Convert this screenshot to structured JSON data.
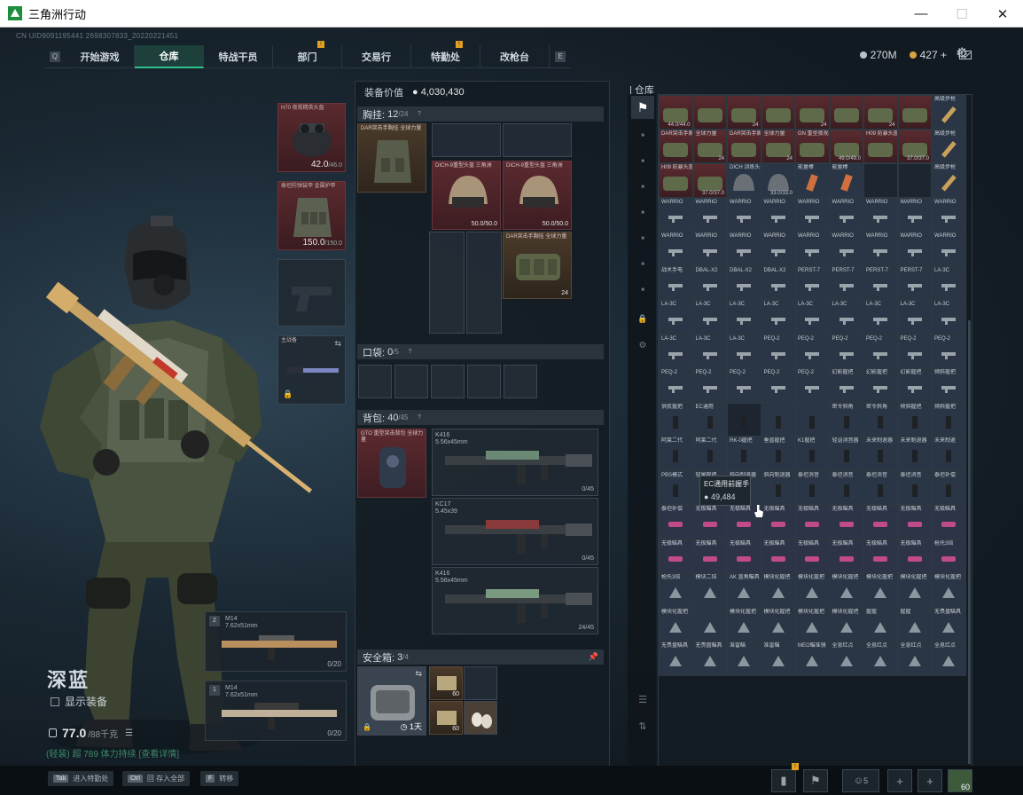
{
  "window": {
    "title": "三角洲行动"
  },
  "uid": "CN UID9091195441 2698307833_20220221451",
  "nav": {
    "key_left": "Q",
    "key_right": "E",
    "tabs": [
      {
        "label": "开始游戏",
        "active": false,
        "dot": false
      },
      {
        "label": "仓库",
        "active": true,
        "dot": false
      },
      {
        "label": "特战干员",
        "active": false,
        "dot": false
      },
      {
        "label": "部门",
        "active": false,
        "dot": true
      },
      {
        "label": "交易行",
        "active": false,
        "dot": false
      },
      {
        "label": "特勤处",
        "active": false,
        "dot": true
      },
      {
        "label": "改枪台",
        "active": false,
        "dot": false
      }
    ],
    "dot_mark": "!"
  },
  "currency": {
    "silver": "270M",
    "gold": "427",
    "gold_plus": "+"
  },
  "colors": {
    "accent": "#2fbf8a",
    "red_item": "#5a2a2e",
    "silver": "#b8c2cc",
    "gold": "#d9a441"
  },
  "player": {
    "name": "深蓝",
    "show_equip": "显示装备",
    "weight": "77.0",
    "weight_max": "/88千克",
    "status": "(轻装) 超 789  体力持续  [查看详情]"
  },
  "gear": {
    "helmet": {
      "label": "H70 夜视精英头盔",
      "dur": "42.0",
      "max": "/46.0"
    },
    "armor": {
      "label": "泰坦防弹装甲 金属护甲",
      "dur": "150.0",
      "max": "/150.0"
    },
    "melee": {
      "label": "主战备"
    },
    "primary1": {
      "num": "2",
      "name": "M14",
      "sub": "7.62x51mm",
      "ammo": "0/20"
    },
    "primary2": {
      "num": "1",
      "name": "M14",
      "sub": "7.62x51mm",
      "ammo": "0/20"
    }
  },
  "mid": {
    "value_label": "装备价值",
    "value": "4,030,430",
    "chest": {
      "label": "胸挂:",
      "value": "12",
      "max": "/24"
    },
    "chest_rig_label": "DAR突击手胸挂 全球力量",
    "chest_items": [
      {
        "label": "DICH-9重型头盔 三角洲",
        "dur": "50.0/50.0"
      },
      {
        "label": "DICH-9重型头盔 三角洲",
        "dur": "50.0/50.0"
      },
      {
        "label": "DAR突击手胸挂 全球力量",
        "dur": "24"
      }
    ],
    "pocket": {
      "label": "口袋:",
      "value": "0",
      "max": "/5"
    },
    "backpack": {
      "label": "背包:",
      "value": "40",
      "max": "/45"
    },
    "backpack_item_label": "GTO 重型突击背包 全球力量",
    "guns": [
      {
        "name": "K416",
        "sub": "5.56x45mm",
        "ammo": "0/45"
      },
      {
        "name": "KC17",
        "sub": "5.45x39",
        "ammo": "0/45"
      },
      {
        "name": "K416",
        "sub": "5.56x45mm",
        "ammo": "24/45"
      }
    ],
    "safebox": {
      "label": "安全箱:",
      "value": "3",
      "max": "/4",
      "time": "1天"
    },
    "safebox_items": [
      {
        "c": "60"
      },
      {
        "c": "60"
      }
    ]
  },
  "inventory": {
    "label": "仓库",
    "rows": [
      [
        {
          "n": "",
          "c": "44.0/44.0",
          "t": "red"
        },
        {
          "n": "",
          "c": "",
          "t": "red"
        },
        {
          "n": "",
          "c": "24",
          "t": "red"
        },
        {
          "n": "",
          "c": "",
          "t": "red"
        },
        {
          "n": "",
          "c": "24",
          "t": "red"
        },
        {
          "n": "",
          "c": "",
          "t": "red"
        },
        {
          "n": "",
          "c": "24",
          "t": "red"
        },
        {
          "n": "",
          "c": "",
          "t": "red"
        },
        {
          "n": "高级步枪",
          "c": "",
          "t": ""
        }
      ],
      [
        {
          "n": "DAR突击手胸挂",
          "c": "",
          "t": "red"
        },
        {
          "n": "全球力量",
          "c": "24",
          "t": "red"
        },
        {
          "n": "DAR突击手胸挂",
          "c": "",
          "t": "red"
        },
        {
          "n": "全球力量",
          "c": "24",
          "t": "red"
        },
        {
          "n": "GN 重型夜视头盔",
          "c": "",
          "t": "red"
        },
        {
          "n": "",
          "c": "49.0/49.0",
          "t": "red"
        },
        {
          "n": "H09 防暴头盔",
          "c": "",
          "t": "red"
        },
        {
          "n": "",
          "c": "37.0/37.0",
          "t": "red"
        },
        {
          "n": "高级步枪",
          "c": "",
          "t": ""
        }
      ],
      [
        {
          "n": "H09 防暴头盔",
          "c": "",
          "t": "red"
        },
        {
          "n": "",
          "c": "37.0/37.0",
          "t": "red"
        },
        {
          "n": "DICH 训练头盔",
          "c": "",
          "t": ""
        },
        {
          "n": "",
          "c": "33.0/33.0",
          "t": ""
        },
        {
          "n": "能量棒",
          "c": "",
          "t": ""
        },
        {
          "n": "能量棒",
          "c": "",
          "t": ""
        },
        {
          "n": "",
          "c": "",
          "t": "dark"
        },
        {
          "n": "",
          "c": "",
          "t": "dark"
        },
        {
          "n": "高级步枪",
          "c": "",
          "t": ""
        }
      ],
      [
        {
          "n": "WARRIO",
          "c": ""
        },
        {
          "n": "WARRIO",
          "c": ""
        },
        {
          "n": "WARRIO",
          "c": ""
        },
        {
          "n": "WARRIO",
          "c": ""
        },
        {
          "n": "WARRIO",
          "c": ""
        },
        {
          "n": "WARRIO",
          "c": ""
        },
        {
          "n": "WARRIO",
          "c": ""
        },
        {
          "n": "WARRIO",
          "c": ""
        },
        {
          "n": "WARRIO",
          "c": ""
        }
      ],
      [
        {
          "n": "WARRIO",
          "c": ""
        },
        {
          "n": "WARRIO",
          "c": ""
        },
        {
          "n": "WARRIO",
          "c": ""
        },
        {
          "n": "WARRIO",
          "c": ""
        },
        {
          "n": "WARRIO",
          "c": ""
        },
        {
          "n": "WARRIO",
          "c": ""
        },
        {
          "n": "WARRIO",
          "c": ""
        },
        {
          "n": "WARRIO",
          "c": ""
        },
        {
          "n": "WARRIO",
          "c": ""
        }
      ],
      [
        {
          "n": "战术手电",
          "c": ""
        },
        {
          "n": "DBAL-X2",
          "c": ""
        },
        {
          "n": "DBAL-X2",
          "c": ""
        },
        {
          "n": "DBAL-X2",
          "c": ""
        },
        {
          "n": "PERST-7",
          "c": ""
        },
        {
          "n": "PERST-7",
          "c": ""
        },
        {
          "n": "PERST-7",
          "c": ""
        },
        {
          "n": "PERST-7",
          "c": ""
        },
        {
          "n": "LA-3C",
          "c": ""
        }
      ],
      [
        {
          "n": "LA-3C",
          "c": ""
        },
        {
          "n": "LA-3C",
          "c": ""
        },
        {
          "n": "LA-3C",
          "c": ""
        },
        {
          "n": "LA-3C",
          "c": ""
        },
        {
          "n": "LA-3C",
          "c": ""
        },
        {
          "n": "LA-3C",
          "c": ""
        },
        {
          "n": "LA-3C",
          "c": ""
        },
        {
          "n": "LA-3C",
          "c": ""
        },
        {
          "n": "LA-3C",
          "c": ""
        }
      ],
      [
        {
          "n": "LA-3C",
          "c": ""
        },
        {
          "n": "LA-3C",
          "c": ""
        },
        {
          "n": "LA-3C",
          "c": ""
        },
        {
          "n": "PEQ-2",
          "c": ""
        },
        {
          "n": "PEQ-2",
          "c": ""
        },
        {
          "n": "PEQ-2",
          "c": ""
        },
        {
          "n": "PEQ-2",
          "c": ""
        },
        {
          "n": "PEQ-2",
          "c": ""
        },
        {
          "n": "PEQ-2",
          "c": ""
        }
      ],
      [
        {
          "n": "PEQ-2",
          "c": ""
        },
        {
          "n": "PEQ-2",
          "c": ""
        },
        {
          "n": "PEQ-2",
          "c": ""
        },
        {
          "n": "PEQ-2",
          "c": ""
        },
        {
          "n": "PEQ-2",
          "c": ""
        },
        {
          "n": "幻影握把",
          "c": ""
        },
        {
          "n": "幻影握把",
          "c": ""
        },
        {
          "n": "幻影握把",
          "c": ""
        },
        {
          "n": "倾斜握把",
          "c": ""
        }
      ],
      [
        {
          "n": "供航握把",
          "c": ""
        },
        {
          "n": "EC通用",
          "c": ""
        },
        {
          "n": "",
          "c": "",
          "t": "dark"
        },
        {
          "n": "",
          "c": ""
        },
        {
          "n": "",
          "c": ""
        },
        {
          "n": "密令斜角",
          "c": ""
        },
        {
          "n": "密令斜角",
          "c": ""
        },
        {
          "n": "倾斜握把",
          "c": ""
        },
        {
          "n": "倾斜握把",
          "c": ""
        }
      ],
      [
        {
          "n": "阿莱二代",
          "c": ""
        },
        {
          "n": "阿莱二代",
          "c": ""
        },
        {
          "n": "RK-0握把",
          "c": ""
        },
        {
          "n": "垂直握把",
          "c": ""
        },
        {
          "n": "K1握把",
          "c": ""
        },
        {
          "n": "轻语消音器",
          "c": ""
        },
        {
          "n": "未来制退器",
          "c": ""
        },
        {
          "n": "未来制退器",
          "c": ""
        },
        {
          "n": "未来制退",
          "c": ""
        }
      ],
      [
        {
          "n": "PBS模式",
          "c": ""
        },
        {
          "n": "轻量握把",
          "c": ""
        },
        {
          "n": "斜向制退器",
          "c": ""
        },
        {
          "n": "斜向制退器",
          "c": ""
        },
        {
          "n": "泰坦消音",
          "c": ""
        },
        {
          "n": "泰坦消音",
          "c": ""
        },
        {
          "n": "泰坦消音",
          "c": ""
        },
        {
          "n": "泰坦消音",
          "c": ""
        },
        {
          "n": "泰坦补偿",
          "c": ""
        }
      ],
      [
        {
          "n": "泰坦补偿",
          "c": "",
          "t": "purple"
        },
        {
          "n": "无极瞄具",
          "c": "",
          "t": "purple"
        },
        {
          "n": "无极瞄具",
          "c": "",
          "t": "purple"
        },
        {
          "n": "无极瞄具",
          "c": "",
          "t": "purple"
        },
        {
          "n": "无极瞄具",
          "c": "",
          "t": "purple"
        },
        {
          "n": "无极瞄具",
          "c": "",
          "t": "purple"
        },
        {
          "n": "无极瞄具",
          "c": "",
          "t": "purple"
        },
        {
          "n": "无极瞄具",
          "c": "",
          "t": "purple"
        },
        {
          "n": "无极瞄具",
          "c": "",
          "t": "purple"
        }
      ],
      [
        {
          "n": "无极瞄具",
          "c": "",
          "t": "purple"
        },
        {
          "n": "无极瞄具",
          "c": "",
          "t": "purple"
        },
        {
          "n": "无极瞄具",
          "c": "",
          "t": "purple"
        },
        {
          "n": "无极瞄具",
          "c": "",
          "t": "purple"
        },
        {
          "n": "无极瞄具",
          "c": "",
          "t": "purple"
        },
        {
          "n": "无极瞄具",
          "c": "",
          "t": "purple"
        },
        {
          "n": "无极瞄具",
          "c": "",
          "t": "purple"
        },
        {
          "n": "无极瞄具",
          "c": "",
          "t": "purple"
        },
        {
          "n": "枪托3倍",
          "c": "",
          "t": "purple"
        }
      ],
      [
        {
          "n": "枪托3倍",
          "c": ""
        },
        {
          "n": "模块二倍",
          "c": ""
        },
        {
          "n": "AK 直角瞄具",
          "c": ""
        },
        {
          "n": "模块化握把",
          "c": ""
        },
        {
          "n": "模块化握把",
          "c": ""
        },
        {
          "n": "模块化握把",
          "c": ""
        },
        {
          "n": "模块化握把",
          "c": ""
        },
        {
          "n": "模块化握把",
          "c": ""
        },
        {
          "n": "模块化握把",
          "c": ""
        }
      ],
      [
        {
          "n": "模块化握把",
          "c": ""
        },
        {
          "n": "",
          "c": ""
        },
        {
          "n": "模块化握把",
          "c": ""
        },
        {
          "n": "模块化握把",
          "c": ""
        },
        {
          "n": "模块化握把",
          "c": ""
        },
        {
          "n": "模块化握把",
          "c": ""
        },
        {
          "n": "握握",
          "c": ""
        },
        {
          "n": "握握",
          "c": ""
        },
        {
          "n": "无畏盘瞄具",
          "c": ""
        }
      ],
      [
        {
          "n": "无畏盘瞄具",
          "c": ""
        },
        {
          "n": "无畏盘瞄具",
          "c": ""
        },
        {
          "n": "准雷瞄",
          "c": ""
        },
        {
          "n": "准雷瞄",
          "c": ""
        },
        {
          "n": "MEO瞄准镜",
          "c": ""
        },
        {
          "n": "全息红点",
          "c": ""
        },
        {
          "n": "全息红点",
          "c": ""
        },
        {
          "n": "全息红点",
          "c": ""
        },
        {
          "n": "全息红点",
          "c": ""
        }
      ]
    ]
  },
  "tooltip": {
    "title": "EC通用前握手",
    "price": "49,484"
  },
  "bottom": {
    "hints": [
      {
        "key": "Tab",
        "label": "进入特勤处"
      },
      {
        "key": "Ctrl",
        "label": "回 存入全部"
      },
      {
        "key": "F",
        "label": "转移"
      }
    ],
    "friends": "5",
    "avatar_level": "60"
  }
}
